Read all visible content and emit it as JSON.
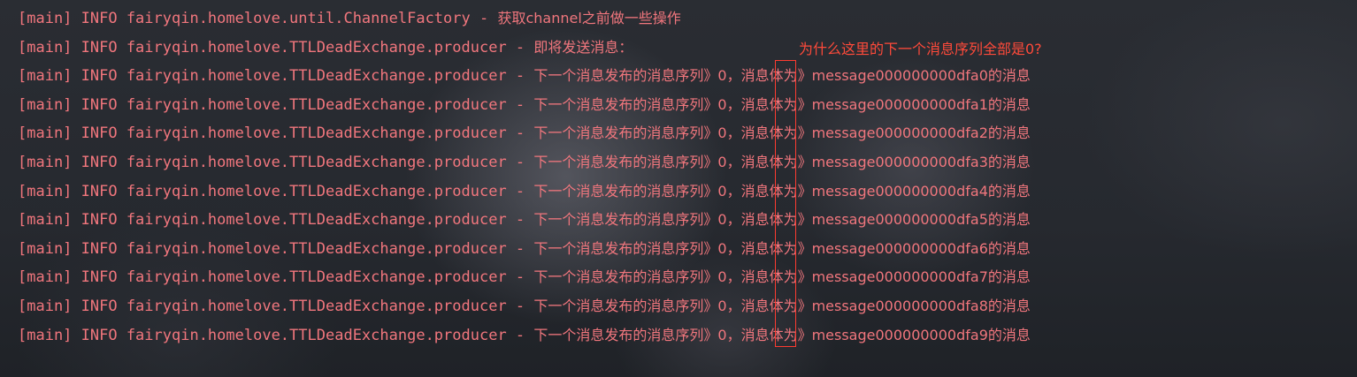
{
  "console": {
    "lines": [
      {
        "prefix": "[main] INFO fairyqin.homelove.until.ChannelFactory - ",
        "message": "获取channel之前做一些操作"
      },
      {
        "prefix": "[main] INFO fairyqin.homelove.TTLDeadExchange.producer - ",
        "message": "即将发送消息："
      },
      {
        "prefix": "[main] INFO fairyqin.homelove.TTLDeadExchange.producer - ",
        "message": "下一个消息发布的消息序列》0，消息体为》message000000000dfa0的消息"
      },
      {
        "prefix": "[main] INFO fairyqin.homelove.TTLDeadExchange.producer - ",
        "message": "下一个消息发布的消息序列》0，消息体为》message000000000dfa1的消息"
      },
      {
        "prefix": "[main] INFO fairyqin.homelove.TTLDeadExchange.producer - ",
        "message": "下一个消息发布的消息序列》0，消息体为》message000000000dfa2的消息"
      },
      {
        "prefix": "[main] INFO fairyqin.homelove.TTLDeadExchange.producer - ",
        "message": "下一个消息发布的消息序列》0，消息体为》message000000000dfa3的消息"
      },
      {
        "prefix": "[main] INFO fairyqin.homelove.TTLDeadExchange.producer - ",
        "message": "下一个消息发布的消息序列》0，消息体为》message000000000dfa4的消息"
      },
      {
        "prefix": "[main] INFO fairyqin.homelove.TTLDeadExchange.producer - ",
        "message": "下一个消息发布的消息序列》0，消息体为》message000000000dfa5的消息"
      },
      {
        "prefix": "[main] INFO fairyqin.homelove.TTLDeadExchange.producer - ",
        "message": "下一个消息发布的消息序列》0，消息体为》message000000000dfa6的消息"
      },
      {
        "prefix": "[main] INFO fairyqin.homelove.TTLDeadExchange.producer - ",
        "message": "下一个消息发布的消息序列》0，消息体为》message000000000dfa7的消息"
      },
      {
        "prefix": "[main] INFO fairyqin.homelove.TTLDeadExchange.producer - ",
        "message": "下一个消息发布的消息序列》0，消息体为》message000000000dfa8的消息"
      },
      {
        "prefix": "[main] INFO fairyqin.homelove.TTLDeadExchange.producer - ",
        "message": "下一个消息发布的消息序列》0，消息体为》message000000000dfa9的消息"
      }
    ]
  },
  "annotation": {
    "question": "为什么这里的下一个消息序列全部是0?"
  },
  "colors": {
    "log_text": "#f1767d",
    "annotation": "#ff4a3a",
    "highlight_box": "#ff3b30",
    "background": "#24272d"
  }
}
